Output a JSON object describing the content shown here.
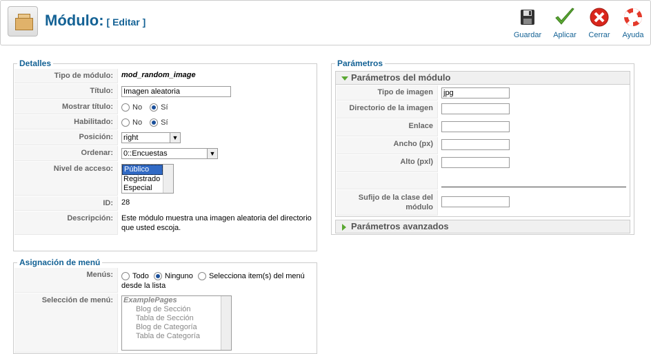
{
  "header": {
    "title": "Módulo:",
    "subtitle": "[ Editar ]",
    "buttons": {
      "save": "Guardar",
      "apply": "Aplicar",
      "close": "Cerrar",
      "help": "Ayuda"
    }
  },
  "details": {
    "legend": "Detalles",
    "type_label": "Tipo de módulo:",
    "type_value": "mod_random_image",
    "title_label": "Título:",
    "title_value": "Imagen aleatoria",
    "show_title_label": "Mostrar título:",
    "enabled_label": "Habilitado:",
    "no": "No",
    "yes": "Sí",
    "position_label": "Posición:",
    "position_value": "right",
    "order_label": "Ordenar:",
    "order_value": "0::Encuestas",
    "access_label": "Nivel de acceso:",
    "access_options": [
      "Público",
      "Registrado",
      "Especial"
    ],
    "id_label": "ID:",
    "id_value": "28",
    "description_label": "Descripción:",
    "description_value": "Este módulo muestra una imagen aleatoria del directorio que usted escoja."
  },
  "menu_assignment": {
    "legend": "Asignación de menú",
    "menus_label": "Menús:",
    "opt_all": "Todo",
    "opt_none": "Ninguno",
    "opt_select": "Selecciona item(s) del menú desde la lista",
    "selection_label": "Selección de menú:",
    "selection_items": [
      "ExamplePages",
      "Blog de Sección",
      "Tabla de Sección",
      "Blog de Categoría",
      "Tabla de Categoría"
    ]
  },
  "parameters": {
    "legend": "Parámetros",
    "module_params_title": "Parámetros del módulo",
    "image_type_label": "Tipo de imagen",
    "image_type_value": "jpg",
    "image_dir_label": "Directorio de la imagen",
    "link_label": "Enlace",
    "width_label": "Ancho (px)",
    "height_label": "Alto (pxl)",
    "suffix_label": "Sufijo de la clase del módulo",
    "advanced_title": "Parámetros avanzados"
  },
  "colors": {
    "brand_blue": "#146295",
    "accent_green": "#5aa832",
    "close_red": "#d9261c"
  }
}
